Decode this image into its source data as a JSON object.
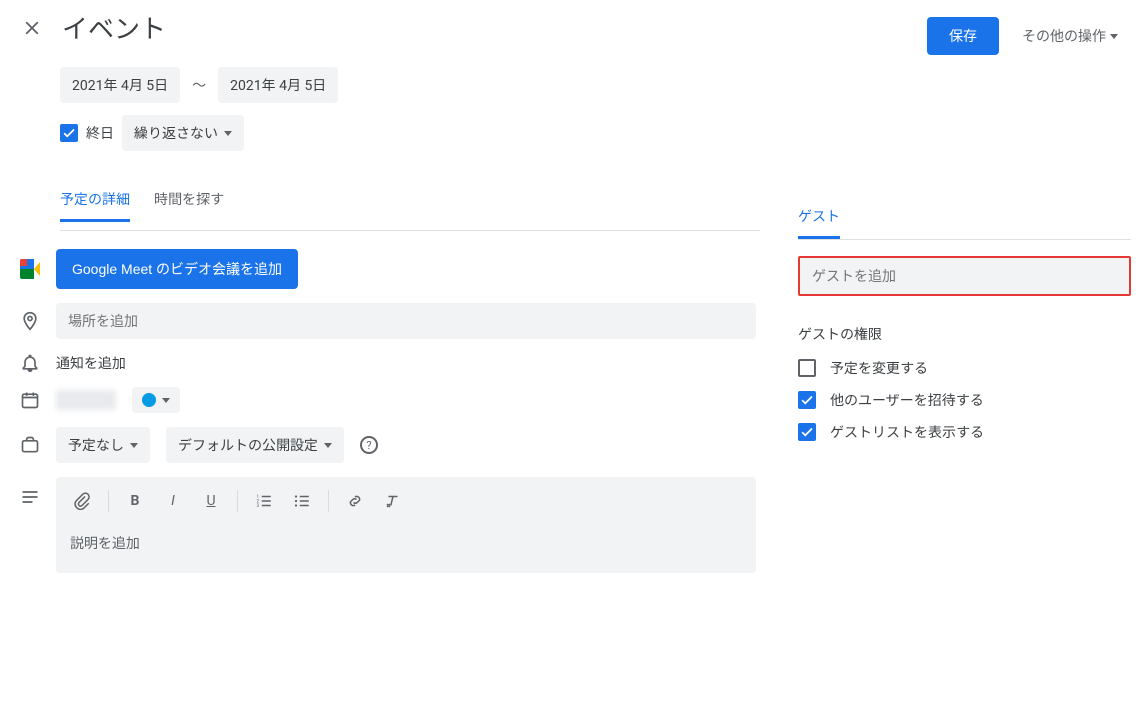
{
  "header": {
    "title": "イベント",
    "save_label": "保存",
    "other_actions_label": "その他の操作"
  },
  "dates": {
    "start": "2021年 4月 5日",
    "end": "2021年 4月 5日",
    "dash": "～"
  },
  "allday": {
    "label": "終日",
    "checked": true
  },
  "recurrence": {
    "label": "繰り返さない"
  },
  "tabs": {
    "details": "予定の詳細",
    "find_time": "時間を探す"
  },
  "meet": {
    "button_label": "Google Meet のビデオ会議を追加"
  },
  "location": {
    "placeholder": "場所を追加"
  },
  "notification": {
    "add_label": "通知を追加"
  },
  "availability": {
    "label": "予定なし"
  },
  "visibility": {
    "label": "デフォルトの公開設定"
  },
  "description": {
    "placeholder": "説明を追加"
  },
  "guest": {
    "tab_label": "ゲスト",
    "input_placeholder": "ゲストを追加",
    "permissions_title": "ゲストの権限",
    "permissions": [
      {
        "label": "予定を変更する",
        "checked": false
      },
      {
        "label": "他のユーザーを招待する",
        "checked": true
      },
      {
        "label": "ゲストリストを表示する",
        "checked": true
      }
    ]
  },
  "colors": {
    "calendar_dot": "#039be5"
  }
}
